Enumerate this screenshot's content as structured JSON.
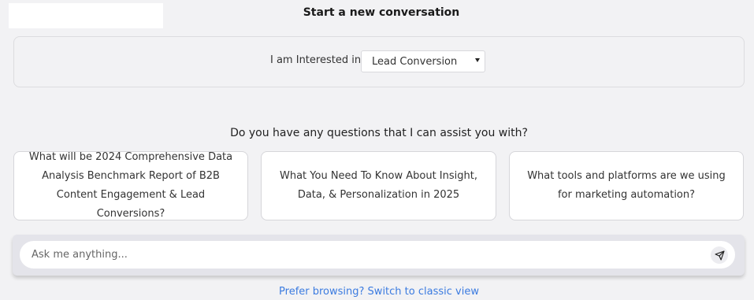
{
  "header": {
    "title": "Start a new conversation"
  },
  "interest": {
    "label": "I am Interested in",
    "selected": "Lead Conversion"
  },
  "questions": {
    "heading": "Do you have any questions that I can assist you with?",
    "cards": [
      {
        "text": "What will be 2024 Comprehensive Data Analysis Benchmark Report of B2B Content Engagement & Lead Conversions?"
      },
      {
        "text": "What You Need To Know About Insight, Data, & Personalization in 2025"
      },
      {
        "text": "What tools and platforms are we using for marketing automation?"
      }
    ]
  },
  "ask": {
    "placeholder": "Ask me anything..."
  },
  "footer": {
    "classic_link": "Prefer browsing? Switch to classic view"
  },
  "icons": {
    "send": "send-icon",
    "dropdown": "chevron-down-icon"
  },
  "colors": {
    "background": "#f2f2f4",
    "link": "#3b7be0",
    "card_bg": "#ffffff"
  }
}
